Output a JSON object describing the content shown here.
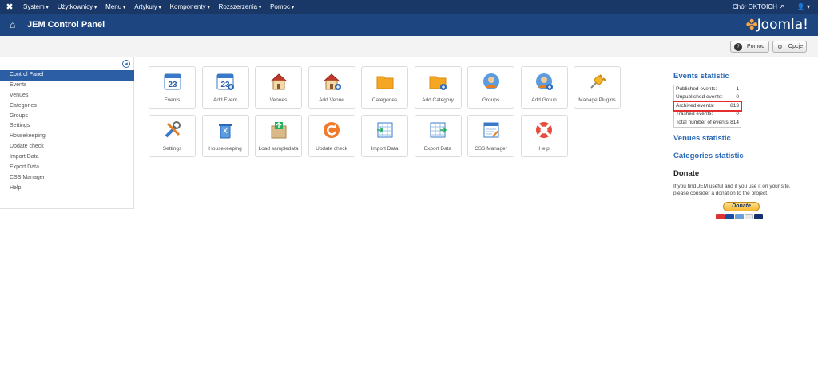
{
  "topbar": {
    "menus": [
      "System",
      "Użytkownicy",
      "Menu",
      "Artykuły",
      "Komponenty",
      "Rozszerzenia",
      "Pomoc"
    ],
    "site_name": "Chór OKTOICH",
    "user_icon": "user-icon"
  },
  "header": {
    "title": "JEM Control Panel",
    "brand": "Joomla!"
  },
  "toolbar": {
    "help_label": "Pomoc",
    "options_label": "Opcje"
  },
  "sidebar": {
    "items": [
      "Control Panel",
      "Events",
      "Venues",
      "Categories",
      "Groups",
      "Settings",
      "Housekeeping",
      "Update check",
      "Import Data",
      "Export Data",
      "CSS Manager",
      "Help"
    ],
    "active_index": 0
  },
  "tiles": [
    {
      "label": "Events",
      "icon": "calendar-icon"
    },
    {
      "label": "Add Event",
      "icon": "calendar-add-icon"
    },
    {
      "label": "Venues",
      "icon": "house-icon"
    },
    {
      "label": "Add Venue",
      "icon": "house-add-icon"
    },
    {
      "label": "Categories",
      "icon": "folder-icon"
    },
    {
      "label": "Add Category",
      "icon": "folder-add-icon"
    },
    {
      "label": "Groups",
      "icon": "users-icon"
    },
    {
      "label": "Add Group",
      "icon": "users-add-icon"
    },
    {
      "label": "Manage Plugins",
      "icon": "plug-icon"
    },
    {
      "label": "Settings",
      "icon": "tools-icon"
    },
    {
      "label": "Housekeeping",
      "icon": "trash-icon"
    },
    {
      "label": "Load sampledata",
      "icon": "box-icon"
    },
    {
      "label": "Update check",
      "icon": "refresh-icon"
    },
    {
      "label": "Import Data",
      "icon": "table-import-icon"
    },
    {
      "label": "Export Data",
      "icon": "table-export-icon"
    },
    {
      "label": "CSS Manager",
      "icon": "css-edit-icon"
    },
    {
      "label": "Help",
      "icon": "lifebuoy-icon"
    }
  ],
  "events_statistic": {
    "title": "Events statistic",
    "rows": [
      {
        "label": "Published events:",
        "value": "1"
      },
      {
        "label": "Unpublished events:",
        "value": "0"
      },
      {
        "label": "Archived events:",
        "value": "813"
      },
      {
        "label": "Trashed events:",
        "value": "0"
      },
      {
        "label": "Total number of events:",
        "value": "814"
      }
    ],
    "highlighted_row": 2,
    "highlight_color": "#e52d2d"
  },
  "venues_statistic": {
    "title": "Venues statistic"
  },
  "categories_statistic": {
    "title": "Categories statistic"
  },
  "donate": {
    "title": "Donate",
    "text": "If you find JEM useful and if you use it on your site, please consider a donation to the project.",
    "button": "Donate"
  },
  "colors": {
    "topbar": "#1a3867",
    "header": "#1d4680",
    "accent": "#2a69b8",
    "sidebar_active": "#2b5ea4"
  }
}
